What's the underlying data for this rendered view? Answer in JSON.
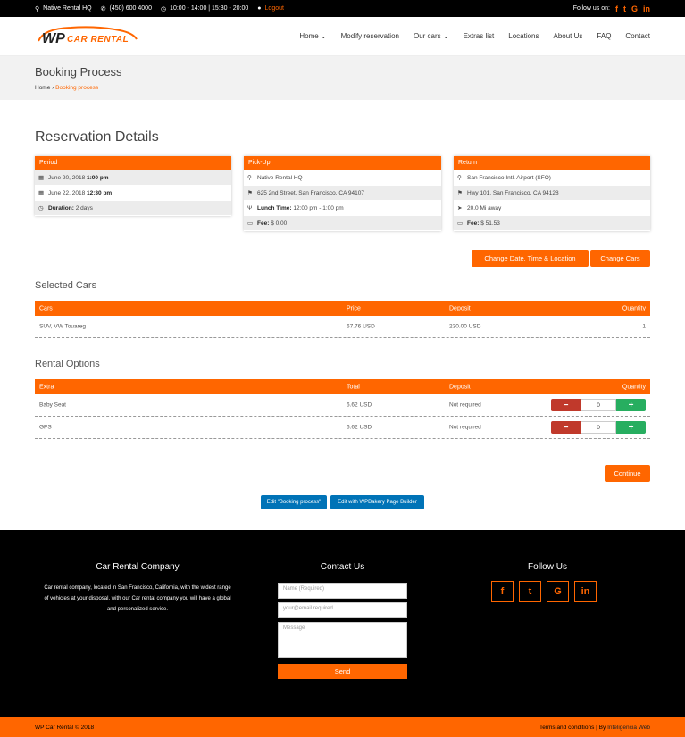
{
  "topbar": {
    "location": "Native Rental HQ",
    "phone": "(450) 600 4000",
    "hours": "10:00 - 14:00 | 15:30 - 20:00",
    "logout": "Logout",
    "follow": "Follow us on:"
  },
  "logo": {
    "wp": "WP",
    "car_rental": "CAR RENTAL"
  },
  "nav": [
    "Home ⌄",
    "Modify reservation",
    "Our cars ⌄",
    "Extras list",
    "Locations",
    "About Us",
    "FAQ",
    "Contact"
  ],
  "page": {
    "title": "Booking Process",
    "breadcrumb_home": "Home",
    "breadcrumb_sep": " › ",
    "breadcrumb_current": "Booking process"
  },
  "reservation": {
    "heading": "Reservation Details",
    "period": {
      "header": "Period",
      "start_date": "June 20, 2018",
      "start_time": "1:00 pm",
      "end_date": "June 22, 2018",
      "end_time": "12:30 pm",
      "duration_label": "Duration:",
      "duration_value": "2 days"
    },
    "pickup": {
      "header": "Pick-Up",
      "name": "Native Rental HQ",
      "address": "625 2nd Street, San Francisco, CA 94107",
      "lunch_label": "Lunch Time:",
      "lunch_value": "12:00 pm - 1:00 pm",
      "fee_label": "Fee:",
      "fee_value": "$ 0.00"
    },
    "return": {
      "header": "Return",
      "name": "San Francisco Intl. Airport (SFO)",
      "address": "Hwy 101, San Francisco, CA 94128",
      "distance": "20.0 Mi away",
      "fee_label": "Fee:",
      "fee_value": "$ 51.53"
    },
    "change_date_button": "Change Date, Time & Location",
    "change_cars_button": "Change Cars"
  },
  "selected_cars": {
    "heading": "Selected Cars",
    "columns": [
      "Cars",
      "Price",
      "Deposit",
      "Quantity"
    ],
    "rows": [
      {
        "car": "SUV, VW Touareg",
        "price": "67.76 USD",
        "deposit": "230.00 USD",
        "quantity": "1"
      }
    ]
  },
  "rental_options": {
    "heading": "Rental Options",
    "columns": [
      "Extra",
      "Total",
      "Deposit",
      "Quantity"
    ],
    "rows": [
      {
        "extra": "Baby Seat",
        "total": "6.62 USD",
        "deposit": "Not required",
        "quantity": "0"
      },
      {
        "extra": "GPS",
        "total": "6.62 USD",
        "deposit": "Not required",
        "quantity": "0"
      }
    ]
  },
  "continue_button": "Continue",
  "edit_buttons": {
    "booking_process": "Edit \"Booking process\"",
    "wpbakery": "Edit with WPBakery Page Builder"
  },
  "footer": {
    "company_title": "Car Rental Company",
    "company_desc": "Car rental company, located in San Francisco, California, with the widest range of vehicles at your disposal, with our Car rental company you will have a global and personalized service.",
    "contact_title": "Contact Us",
    "name_placeholder": "Name (Required)",
    "email_placeholder": "your@email.required",
    "message_placeholder": "Message",
    "send_button": "Send",
    "follow_title": "Follow Us"
  },
  "bottombar": {
    "copyright": "WP Car Rental © 2018",
    "terms": "Terms and conditions",
    "sep": " | By ",
    "author": "Inteligencia Web"
  },
  "colors": {
    "accent": "#ff6600",
    "minus": "#c0392b",
    "plus": "#27ae60",
    "edit": "#0073b7"
  }
}
